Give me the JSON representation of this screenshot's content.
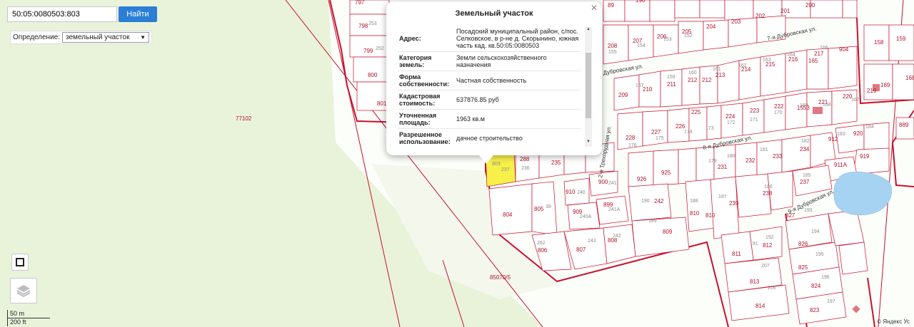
{
  "search": {
    "value": "50:05:0080503:803",
    "button_label": "Найти"
  },
  "define": {
    "label": "Определение:",
    "selected": "земельный участок"
  },
  "popup": {
    "title": "Земельный участок",
    "rows": [
      {
        "key": "Адрес:",
        "value": "Посадский муниципальный район, с/пос. Селковское, в р-не д. Скорынино, южная часть кад. кв.50:05:0080503"
      },
      {
        "key": "Категория земель:",
        "value": "Земли сельскохозяйственного назначения"
      },
      {
        "key": "Форма собственности:",
        "value": "Частная собственность"
      },
      {
        "key": "Кадастровая стоимость:",
        "value": "637876.85 руб"
      },
      {
        "key": "Уточненная площадь:",
        "value": "1963 кв.м"
      },
      {
        "key": "Разрешенное использование:",
        "value": "дачное строительство"
      }
    ],
    "close_icon": "close-icon"
  },
  "map": {
    "streets": [
      "7-я Дубровская ул.",
      "Дубровская ул.",
      "8-я Дубровская ул.",
      "9-я Дубровская ул.",
      "2-я Трехпрудная ул."
    ],
    "areas": [
      "77102",
      "85070/5"
    ],
    "colors": {
      "background": "#e9f3da",
      "plot_fill": "#ffffff",
      "boundary": "#c8102e",
      "selected": "#f7f04a",
      "water": "#a6d3f2"
    }
  },
  "scale": {
    "meters": "50 m",
    "feet": "200 ft"
  },
  "copyright": "© Яндекс  Ус"
}
